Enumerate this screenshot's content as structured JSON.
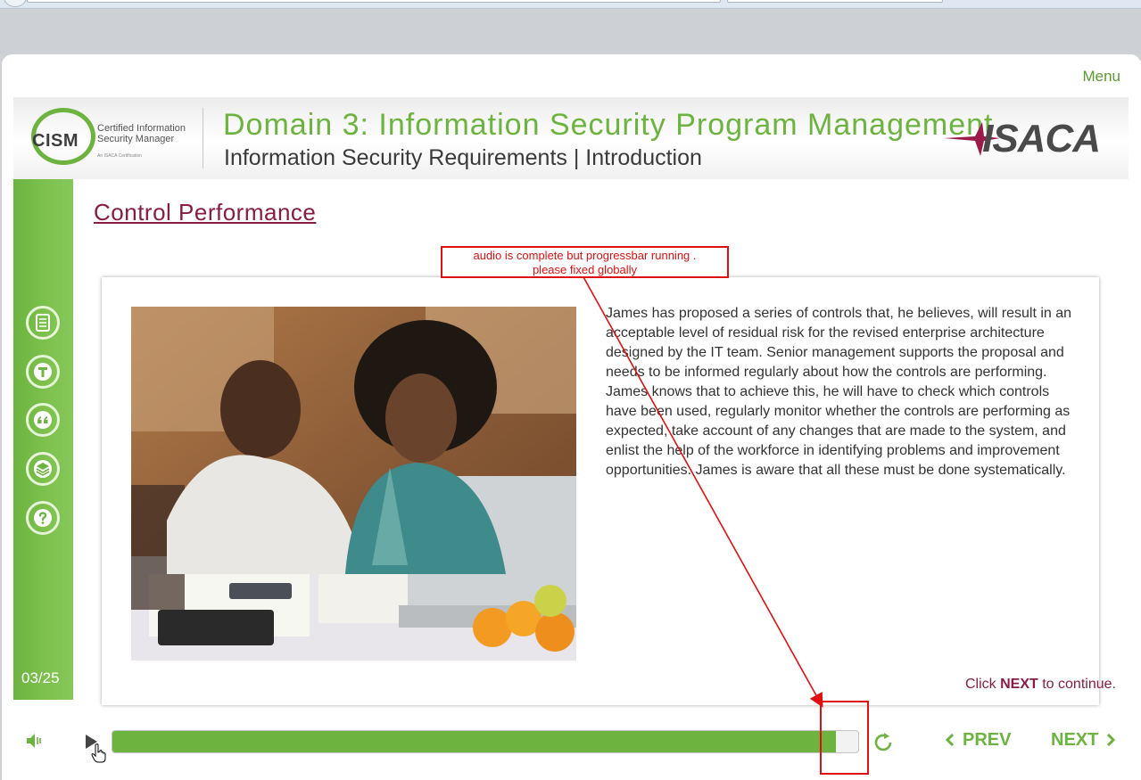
{
  "menu": {
    "label": "Menu"
  },
  "banner": {
    "cism_abbr": "CISM",
    "cism_line1": "Certified Information",
    "cism_line2": "Security Manager",
    "cism_tagline": "An ISACA Certification",
    "domain_title": "Domain 3: Information Security Program Management",
    "sub_title": "Information Security Requirements | Introduction",
    "org_logo": "ISACA"
  },
  "sidebar": {
    "icons": [
      "notes-icon",
      "transcript-icon",
      "quote-icon",
      "resources-icon",
      "help-icon"
    ],
    "page_counter": "03/25"
  },
  "page": {
    "title": "Control Performance",
    "body": "James has proposed a series of controls that, he believes, will result in an acceptable level of residual risk for the revised enterprise architecture designed by the IT team. Senior management supports the proposal and needs to be informed regularly about how the controls are performing. James knows that to achieve this, he will have to check which controls have been used, regularly monitor whether the controls are performing as expected, take account of any changes that are made to the system, and enlist the help of the workforce in identifying problems and improvement opportunities. James is aware that all these must be done systematically.",
    "instruction_prefix": "Click ",
    "instruction_bold": "NEXT",
    "instruction_suffix": " to continue."
  },
  "annotation": {
    "line1": "audio is complete but progressbar running .",
    "line2": "please fixed globally",
    "color": "#e01010"
  },
  "player": {
    "progress_fraction": 0.97,
    "prev_label": "PREV",
    "next_label": "NEXT"
  },
  "colors": {
    "accent_green": "#6db33f",
    "title_maroon": "#8a1c44"
  }
}
